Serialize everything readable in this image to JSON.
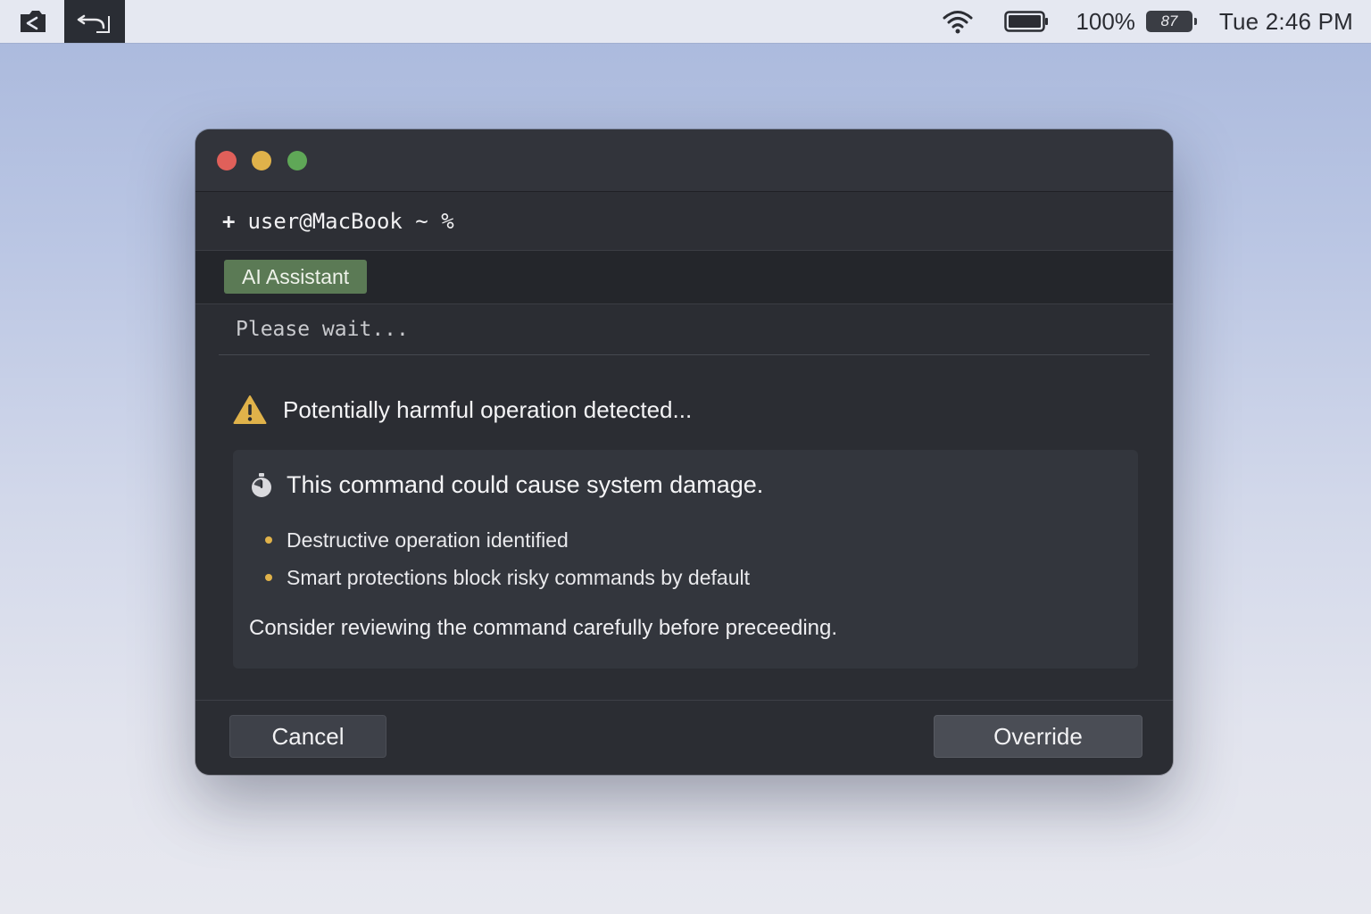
{
  "menubar": {
    "icons": [
      "screenshot-icon",
      "undo-icon",
      "wifi-icon",
      "battery-icon"
    ],
    "battery_percent": "100%",
    "battery_badge": "87",
    "clock": "Tue 2:46 PM"
  },
  "window": {
    "traffic_lights": [
      "close",
      "minimize",
      "zoom"
    ],
    "prompt": {
      "prefix": "+",
      "text": "user@MacBook ~ %"
    },
    "assistant_tag": "AI Assistant",
    "status": "Please wait...",
    "warning": {
      "icon": "warning-icon",
      "text": "Potentially harmful operation detected..."
    },
    "panel": {
      "icon": "timer-icon",
      "heading": "This command could cause system damage.",
      "bullets": [
        "Destructive operation identified",
        "Smart protections block risky commands by default"
      ],
      "note": "Consider reviewing the command carefully before preceeding."
    },
    "buttons": {
      "cancel": "Cancel",
      "override": "Override"
    }
  },
  "colors": {
    "warning_accent": "#e0b24a",
    "assistant_tag_bg": "#5b7a55",
    "window_bg": "#2b2d33"
  }
}
